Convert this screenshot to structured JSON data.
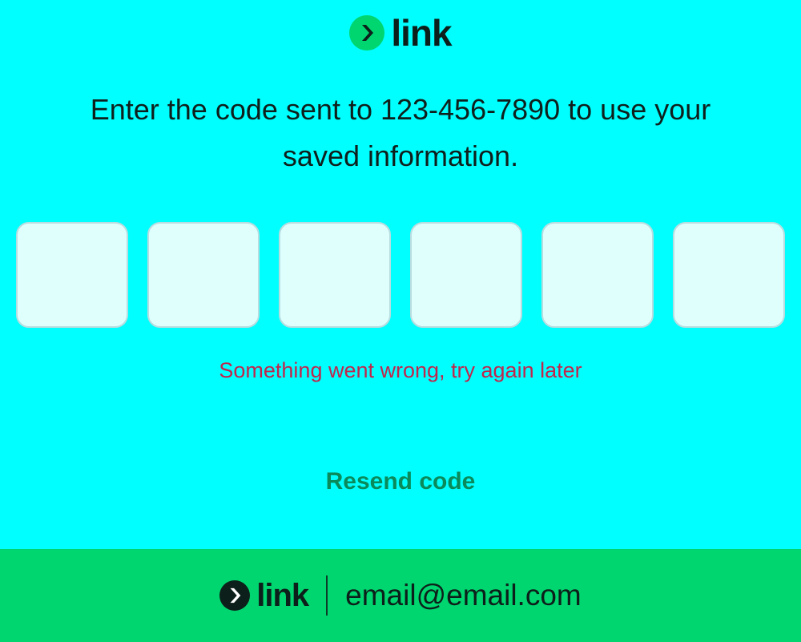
{
  "brand": {
    "name": "link",
    "accent_color": "#00d66f",
    "logo_icon": "chevron-right-icon"
  },
  "verification": {
    "message": "Enter the code sent to 123-456-7890 to use your saved information.",
    "code_digits": [
      "",
      "",
      "",
      "",
      "",
      ""
    ],
    "error": "Something went wrong, try again later",
    "resend_label": "Resend code"
  },
  "footer": {
    "brand": "link",
    "email": "email@email.com"
  },
  "colors": {
    "background": "#00ffff",
    "error": "#c0264c",
    "link": "#0a8a5a",
    "footer_background": "#00d66f"
  }
}
